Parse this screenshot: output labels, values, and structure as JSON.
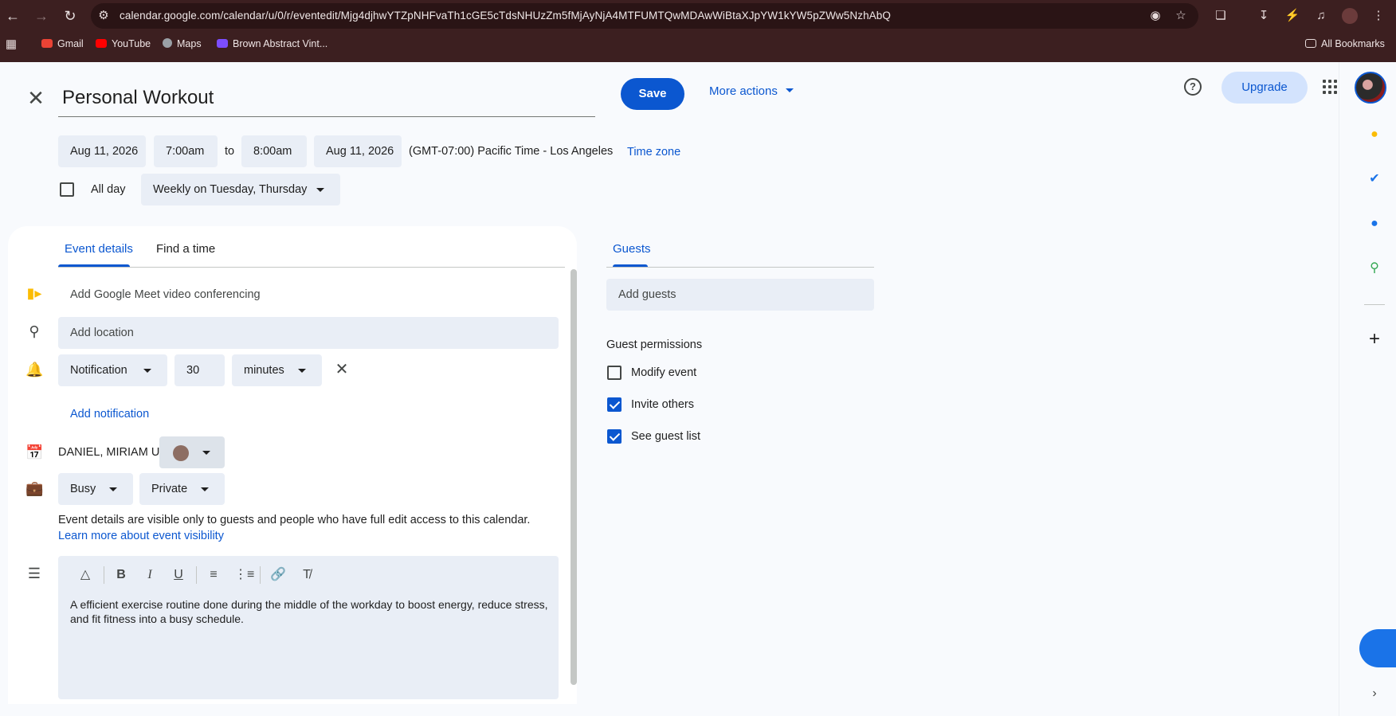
{
  "browser": {
    "url": "calendar.google.com/calendar/u/0/r/eventedit/Mjg4djhwYTZpNHFvaTh1cGE5cTdsNHUzZm5fMjAyNjA4MTFUMTQwMDAwWiBtaXJpYW1kYW5pZWw5NzhAbQ",
    "bookmarks": [
      "Gmail",
      "YouTube",
      "Maps",
      "Brown Abstract Vint..."
    ],
    "all_bookmarks": "All Bookmarks"
  },
  "event": {
    "title": "Personal Workout",
    "start_date": "Aug 11, 2026",
    "start_time": "7:00am",
    "to_label": "to",
    "end_time": "8:00am",
    "end_date": "Aug 11, 2026",
    "timezone_text": "(GMT-07:00) Pacific Time - Los Angeles",
    "timezone_link": "Time zone",
    "all_day_label": "All day",
    "recurrence": "Weekly on Tuesday, Thursday"
  },
  "header": {
    "save": "Save",
    "more_actions": "More actions",
    "help": "?",
    "upgrade": "Upgrade"
  },
  "tabs": [
    "Event details",
    "Find a time"
  ],
  "details": {
    "meet": "Add Google Meet video conferencing",
    "location_placeholder": "Add location",
    "notification_type": "Notification",
    "notification_value": "30",
    "notification_unit": "minutes",
    "add_notification": "Add notification",
    "calendar_owner": "DANIEL, MIRIAM U.",
    "calendar_color": "#8d6e63",
    "availability": "Busy",
    "visibility": "Private",
    "visibility_note": "Event details are visible only to guests and people who have full edit access to this calendar.",
    "visibility_link": "Learn more about event visibility",
    "description": "A efficient exercise routine done during the middle of the workday to boost energy, reduce stress, and fit fitness into a busy schedule."
  },
  "guests": {
    "tab": "Guests",
    "placeholder": "Add guests",
    "permissions_title": "Guest permissions",
    "permissions": [
      {
        "label": "Modify event",
        "checked": false
      },
      {
        "label": "Invite others",
        "checked": true
      },
      {
        "label": "See guest list",
        "checked": true
      }
    ]
  },
  "colors": {
    "accent": "#0b57d0",
    "chrome": "#3c1f20"
  }
}
